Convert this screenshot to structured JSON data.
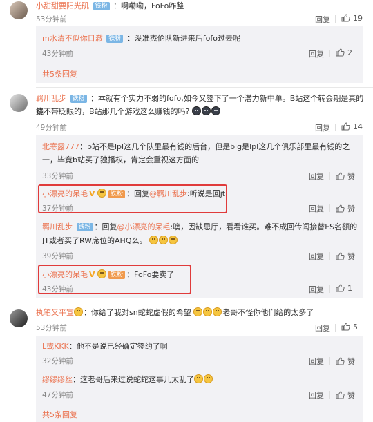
{
  "comments": [
    {
      "user": "小甜甜要阳光矶",
      "badge": "铁粉",
      "text": "：啊嘞嘞，FoFo咋整",
      "time": "53分钟前",
      "reply": "回复",
      "likes": "19",
      "replies": [
        {
          "user": "m水清不似你目澈",
          "badge": "铁粉",
          "text": "：没准杰伦队新进来后fofo过去呢",
          "time": "43分钟前",
          "reply": "回复",
          "likes": "2"
        }
      ],
      "more": "共5条回复"
    },
    {
      "user": "羁川乱步",
      "badge": "铁粉",
      "text_line1": "：本就有个实力不弱的fofo,如今又签下了一个潜力新中单。B站这个转会期是真的烧",
      "text_line2": "钱不带眨眼的，B站那几个游戏这么赚钱的吗?",
      "time": "49分钟前",
      "reply": "回复",
      "likes": "14",
      "replies": [
        {
          "user": "北寒露777",
          "text_line1": "：b站不是lpl这几个队里最有钱的后台，但是blg是lpl这几个俱乐部里最有钱的之",
          "text_line2": "一，毕竟b站买了独播权，肯定会重视这方面的",
          "time": "33分钟前",
          "reply": "回复",
          "likes": "赞"
        },
        {
          "user": "小漂亮的呆毛",
          "vip": "V",
          "badge": "铁粉",
          "text_prefix": "：回复",
          "mention": "@羁川乱步",
          "text": ":听说是回jt",
          "time": "37分钟前",
          "reply": "回复",
          "likes": "赞"
        },
        {
          "user": "羁川乱步",
          "badge": "铁粉",
          "text_prefix": "：回复",
          "mention": "@小漂亮的呆毛",
          "text_line1": ":噢，因缺思厅，看看谁买。难不成回传闻接替ES名额的",
          "text_line2": "JT或者买了RW席位的AHQ么。",
          "time": "39分钟前",
          "reply": "回复",
          "likes": "赞"
        },
        {
          "user": "小漂亮的呆毛",
          "vip": "V",
          "badge": "铁粉",
          "text": "：FoFo要卖了",
          "time": "43分钟前",
          "reply": "回复",
          "likes": "1"
        }
      ]
    },
    {
      "user": "执笔又平宣",
      "text": "：你给了我对sn蛇蛇虚假的希望",
      "text_after": "老哥不怪你他们给的太多了",
      "time": "53分钟前",
      "reply": "回复",
      "likes": "5",
      "replies": [
        {
          "user": "L或KKK",
          "text": "：他不是说已经确定签约了啊",
          "time": "32分钟前",
          "reply": "回复",
          "likes": "赞"
        },
        {
          "user": "缪缪缪丝",
          "text": "：这老哥后来过说蛇蛇这事儿太乱了",
          "time": "47分钟前",
          "reply": "回复",
          "likes": "赞"
        }
      ],
      "more": "共5条回复"
    }
  ],
  "colors": {
    "name": "#eb7350",
    "badge": "#7bb6e5",
    "highlight": "#e03b3b"
  }
}
